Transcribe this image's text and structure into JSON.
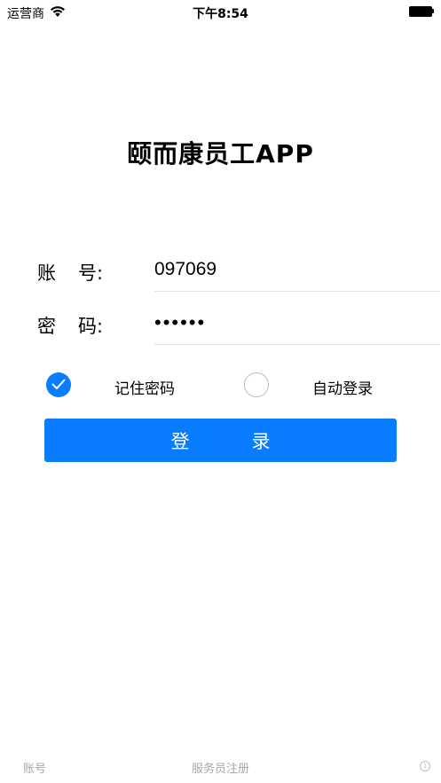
{
  "status_bar": {
    "carrier": "运营商",
    "time": "下午8:54"
  },
  "app": {
    "title": "颐而康员工APP"
  },
  "login_form": {
    "account_label_1": "账",
    "account_label_2": "号:",
    "account_value": "097069",
    "password_label_1": "密",
    "password_label_2": "码:",
    "password_value": "••••••",
    "remember_label": "记住密码",
    "remember_checked": true,
    "auto_login_label": "自动登录",
    "auto_login_checked": false,
    "login_button": "登录"
  },
  "bottom_bar": {
    "account": "账号",
    "register": "服务员注册",
    "info_icon": "i"
  },
  "colors": {
    "accent": "#0a7cff",
    "muted_text": "#a8a8a8"
  }
}
